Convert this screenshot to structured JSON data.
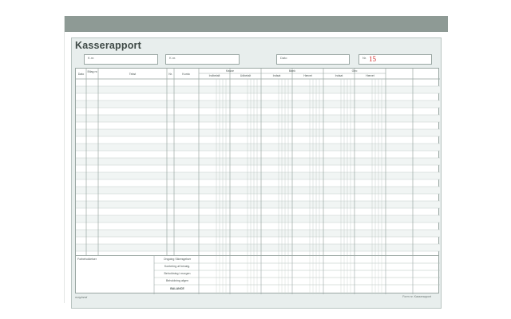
{
  "title": "Kasserapport",
  "header_fields": [
    {
      "label": "K.nr.",
      "value": ""
    },
    {
      "label": "K.nr.",
      "value": ""
    },
    {
      "label": "Dato",
      "value": ""
    },
    {
      "label": "Nr.",
      "value": "15"
    }
  ],
  "columns": {
    "dato": "Dato",
    "bilag": "Bilag nr.",
    "tekst": "Tekst",
    "nr": "Nr.",
    "konto": "Konto"
  },
  "groups": [
    {
      "label": "Kasse",
      "sub": [
        "Indbetalt",
        "Udbetalt"
      ]
    },
    {
      "label": "Bank",
      "sub": [
        "Indsat",
        "Hævet"
      ]
    },
    {
      "label": "Giro",
      "sub": [
        "Indsat",
        "Hævet"
      ]
    }
  ],
  "bottom": {
    "left_label": "Forbeholdelser",
    "rows": [
      "Ongoing Sikresgelser",
      "Kontering af bevæg.",
      "Beholdning i morgen",
      "Beholdning afgen",
      "BALANCE"
    ]
  },
  "footer": {
    "brand": "mayland",
    "form_number": "Form nr. Kasserapport"
  }
}
